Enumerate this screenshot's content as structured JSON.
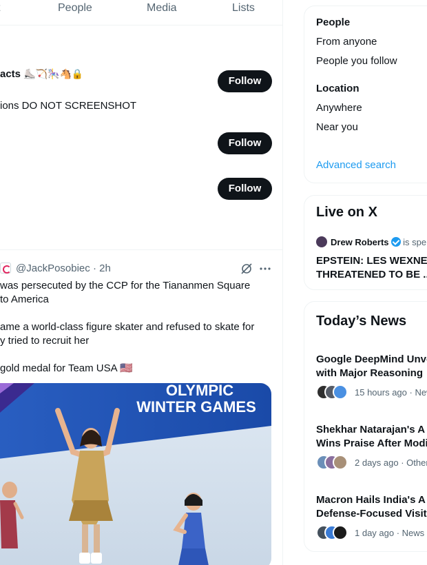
{
  "tabs": [
    "t",
    "People",
    "Media",
    "Lists"
  ],
  "users": [
    {
      "name": "acts",
      "emoji": "⛸️🏹🎠🐴🔒",
      "bio": "ions DO NOT SCREENSHOT",
      "follow_label": "Follow"
    },
    {
      "name": "",
      "emoji": "",
      "bio": "",
      "follow_label": "Follow"
    },
    {
      "name": "",
      "emoji": "",
      "bio": "",
      "follow_label": "Follow"
    }
  ],
  "tweet": {
    "handle": "@JackPosobiec",
    "time": "· 2h",
    "lines": [
      "was persecuted by the CCP for the Tiananmen Square",
      "to America",
      "ame a world-class figure skater and refused to skate for",
      "y tried to recruit her",
      "gold medal for Team USA 🇺🇸"
    ],
    "media_text": [
      "OLYMPIC",
      "WINTER GAMES"
    ]
  },
  "search_filters": {
    "people_heading": "People",
    "people_options": [
      "From anyone",
      "People you follow"
    ],
    "location_heading": "Location",
    "location_options": [
      "Anywhere",
      "Near you"
    ],
    "advanced_label": "Advanced search"
  },
  "live": {
    "title": "Live on X",
    "host": "Drew Roberts",
    "status": "is spe",
    "line1": "EPSTEIN: LES WEXNER",
    "line2": "THREATENED TO BE ..."
  },
  "news": {
    "title": "Today’s News",
    "items": [
      {
        "line1": "Google DeepMind Unve",
        "line2": "with Major Reasoning",
        "meta": "15 hours ago · New"
      },
      {
        "line1": "Shekhar Natarajan's A",
        "line2": "Wins Praise After Modi",
        "meta": "2 days ago · Other"
      },
      {
        "line1": "Macron Hails India's A",
        "line2": "Defense-Focused Visit",
        "meta": "1 day ago · News ·"
      }
    ]
  },
  "colors": {
    "accent": "#1d9bf0",
    "text": "#0f1419",
    "muted": "#536471",
    "border": "#eff3f4",
    "button": "#0f1419"
  }
}
